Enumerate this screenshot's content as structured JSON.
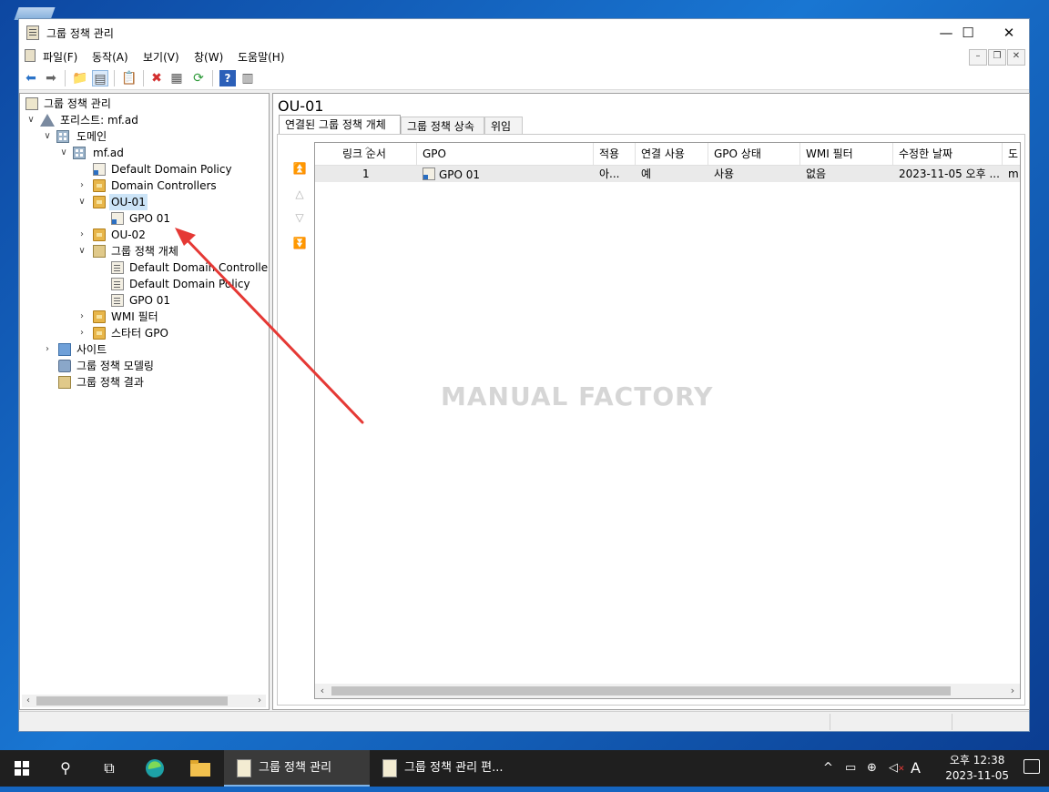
{
  "window": {
    "title": "그룹 정책 관리",
    "controls": {
      "minimize": "—",
      "maximize": "☐",
      "close": "✕"
    }
  },
  "menubar": {
    "items": [
      "파일(F)",
      "동작(A)",
      "보기(V)",
      "창(W)",
      "도움말(H)"
    ]
  },
  "tree": {
    "root": "그룹 정책 관리",
    "forest": "포리스트: mf.ad",
    "domains": "도메인",
    "domain": "mf.ad",
    "default_domain_policy": "Default Domain Policy",
    "domain_controllers": "Domain Controllers",
    "ou01": "OU-01",
    "ou01_gpo": "GPO 01",
    "ou02": "OU-02",
    "gpo_objects": "그룹 정책 개체",
    "gpo_obj_1": "Default Domain Controllers",
    "gpo_obj_2": "Default Domain Policy",
    "gpo_obj_3": "GPO 01",
    "wmi_filters": "WMI 필터",
    "starter_gpo": "스타터 GPO",
    "sites": "사이트",
    "modeling": "그룹 정책 모델링",
    "results": "그룹 정책 결과"
  },
  "right_pane": {
    "title": "OU-01",
    "tabs": [
      "연결된 그룹 정책 개체",
      "그룹 정책 상속",
      "위임"
    ],
    "columns": [
      "링크 순서",
      "GPO",
      "적용",
      "연결 사용",
      "GPO 상태",
      "WMI 필터",
      "수정한 날짜",
      "도"
    ],
    "rows": [
      {
        "order": "1",
        "gpo": "GPO 01",
        "enforced": "아...",
        "link_enabled": "예",
        "status": "사용",
        "wmi": "없음",
        "modified": "2023-11-05 오후 ...",
        "domain": "m"
      }
    ]
  },
  "watermark": "MANUAL FACTORY",
  "colors": {
    "accent": "#cce4f7",
    "annotation_arrow": "#e53935"
  },
  "taskbar": {
    "apps": [
      {
        "label": "그룹 정책 관리"
      },
      {
        "label": "그룹 정책 관리 편..."
      }
    ],
    "ime": "A",
    "clock_time": "오후 12:38",
    "clock_date": "2023-11-05"
  }
}
